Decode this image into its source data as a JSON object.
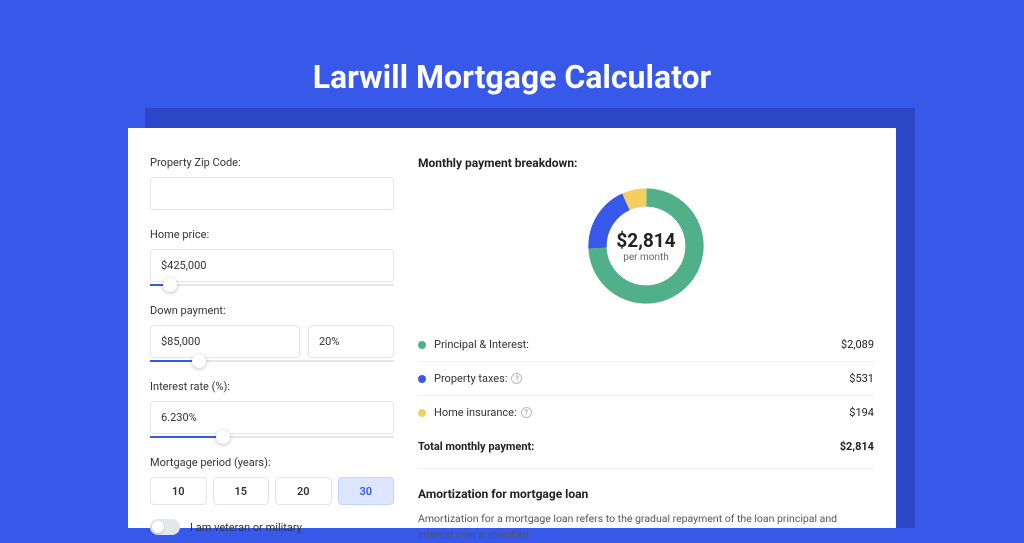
{
  "title": "Larwill Mortgage Calculator",
  "form": {
    "zip_label": "Property Zip Code:",
    "zip_value": "",
    "home_price_label": "Home price:",
    "home_price_value": "$425,000",
    "home_price_slider_pct": 8,
    "down_payment_label": "Down payment:",
    "down_payment_amount": "$85,000",
    "down_payment_pct": "20%",
    "down_payment_slider_pct": 20,
    "interest_label": "Interest rate (%):",
    "interest_value": "6.230%",
    "interest_slider_pct": 30,
    "period_label": "Mortgage period (years):",
    "period_options": [
      "10",
      "15",
      "20",
      "30"
    ],
    "period_active": "30",
    "veteran_label": "I am veteran or military"
  },
  "breakdown": {
    "title": "Monthly payment breakdown:",
    "center_amount": "$2,814",
    "center_sub": "per month",
    "items": [
      {
        "label": "Principal & Interest:",
        "value": "$2,089",
        "color": "#4fb08a",
        "info": false
      },
      {
        "label": "Property taxes:",
        "value": "$531",
        "color": "#3858e9",
        "info": true
      },
      {
        "label": "Home insurance:",
        "value": "$194",
        "color": "#f4ce5e",
        "info": true
      }
    ],
    "total_label": "Total monthly payment:",
    "total_value": "$2,814"
  },
  "amortization": {
    "title": "Amortization for mortgage loan",
    "body": "Amortization for a mortgage loan refers to the gradual repayment of the loan principal and interest over a specified"
  },
  "chart_data": {
    "type": "pie",
    "title": "Monthly payment breakdown",
    "series": [
      {
        "name": "Principal & Interest",
        "value": 2089,
        "color": "#4fb08a"
      },
      {
        "name": "Property taxes",
        "value": 531,
        "color": "#3858e9"
      },
      {
        "name": "Home insurance",
        "value": 194,
        "color": "#f4ce5e"
      }
    ],
    "total": 2814,
    "unit": "USD per month"
  }
}
